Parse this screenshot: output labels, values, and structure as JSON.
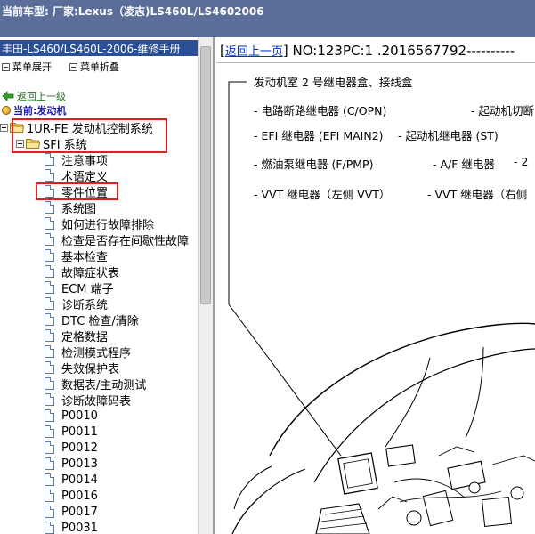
{
  "window": {
    "title": "当前车型:   厂家:Lexus（凌志)LS460L/LS4602006"
  },
  "left_panel": {
    "header": "丰田-LS460/LS460L-2006-维修手册",
    "expand_all": "菜单展开",
    "collapse_all": "菜单折叠",
    "back_link": "返回上一级",
    "current_label": "当前:发动机",
    "tree": {
      "root": "1UR-FE 发动机控制系统",
      "child": "SFI 系统",
      "items": [
        "注意事项",
        "术语定义",
        "零件位置",
        "系统图",
        "如何进行故障排除",
        "检查是否存在间歇性故障",
        "基本检查",
        "故障症状表",
        "ECM 端子",
        "诊断系统",
        "DTC 检查/清除",
        "定格数据",
        "检测模式程序",
        "失效保护表",
        "数据表/主动测试",
        "诊断故障码表",
        "P0010",
        "P0011",
        "P0012",
        "P0013",
        "P0014",
        "P0016",
        "P0017",
        "P0031"
      ]
    }
  },
  "doc": {
    "back_link": "返回上一页",
    "number": "NO:123PC:1 .2016567792----------",
    "open_bracket": "[",
    "close_bracket": "]",
    "diagram": {
      "heading": "发动机室 2 号继电器盒、接线盒",
      "l1a": "- 电路断路继电器 (C/OPN)",
      "l1b": "- 起动机切断",
      "l2a": "- EFI 继电器 (EFI MAIN2)",
      "l2b": "- 起动机继电器 (ST)",
      "l3a": "- 燃油泵继电器 (F/PMP)",
      "l3b": "- A/F 继电器",
      "l3c": "- 2",
      "l4a": "- VVT 继电器（左侧 VVT）",
      "l4b": "- VVT 继电器（右侧"
    }
  },
  "colors": {
    "title_bg": "#5b6e9a",
    "left_header_bg": "#2b4f96",
    "highlight_box": "#e02020",
    "link_blue": "#0033cc",
    "current_text": "#1a1aa6"
  }
}
